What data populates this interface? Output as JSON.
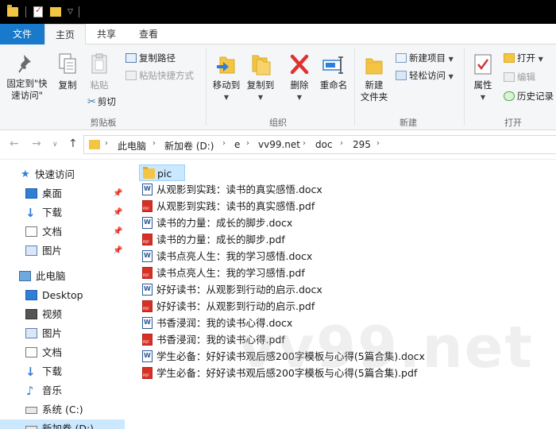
{
  "ribbon_tabs": {
    "file": "文件",
    "home": "主页",
    "share": "共享",
    "view": "查看"
  },
  "clipboard": {
    "pin_quick_access_1": "固定到\"快",
    "pin_quick_access_2": "速访问\"",
    "copy": "复制",
    "paste": "粘贴",
    "copy_path": "复制路径",
    "paste_shortcut": "粘贴快捷方式",
    "cut": "剪切",
    "label": "剪贴板"
  },
  "organize": {
    "move_to": "移动到",
    "copy_to": "复制到",
    "delete": "删除",
    "rename": "重命名",
    "label": "组织"
  },
  "new": {
    "new_folder_1": "新建",
    "new_folder_2": "文件夹",
    "new_item": "新建项目",
    "easy_access": "轻松访问",
    "label": "新建"
  },
  "open": {
    "properties": "属性",
    "open": "打开",
    "edit": "编辑",
    "history": "历史记录",
    "label": "打开"
  },
  "breadcrumb": [
    "此电脑",
    "新加卷 (D:)",
    "e",
    "vv99.net",
    "doc",
    "295"
  ],
  "nav_pane": {
    "quick_access": "快速访问",
    "quick_items": [
      "桌面",
      "下载",
      "文档",
      "图片"
    ],
    "this_pc": "此电脑",
    "pc_items": [
      "Desktop",
      "视频",
      "图片",
      "文档",
      "下载",
      "音乐",
      "系统 (C:)",
      "新加卷 (D:)"
    ]
  },
  "files": [
    {
      "name": "pic",
      "type": "folder"
    },
    {
      "name": "从观影到实践：读书的真实感悟.docx",
      "type": "docx"
    },
    {
      "name": "从观影到实践：读书的真实感悟.pdf",
      "type": "pdf"
    },
    {
      "name": "读书的力量：成长的脚步.docx",
      "type": "docx"
    },
    {
      "name": "读书的力量：成长的脚步.pdf",
      "type": "pdf"
    },
    {
      "name": "读书点亮人生：我的学习感悟.docx",
      "type": "docx"
    },
    {
      "name": "读书点亮人生：我的学习感悟.pdf",
      "type": "pdf"
    },
    {
      "name": "好好读书：从观影到行动的启示.docx",
      "type": "docx"
    },
    {
      "name": "好好读书：从观影到行动的启示.pdf",
      "type": "pdf"
    },
    {
      "name": "书香浸润：我的读书心得.docx",
      "type": "docx"
    },
    {
      "name": "书香浸润：我的读书心得.pdf",
      "type": "pdf"
    },
    {
      "name": "学生必备：好好读书观后感200字模板与心得(5篇合集).docx",
      "type": "docx"
    },
    {
      "name": "学生必备：好好读书观后感200字模板与心得(5篇合集).pdf",
      "type": "pdf"
    }
  ],
  "watermark": "vv99.net",
  "colors": {
    "accent": "#1979ca",
    "selection": "#cce8ff",
    "folder": "#f4c542",
    "pdf": "#d93025",
    "word": "#2b5797"
  }
}
